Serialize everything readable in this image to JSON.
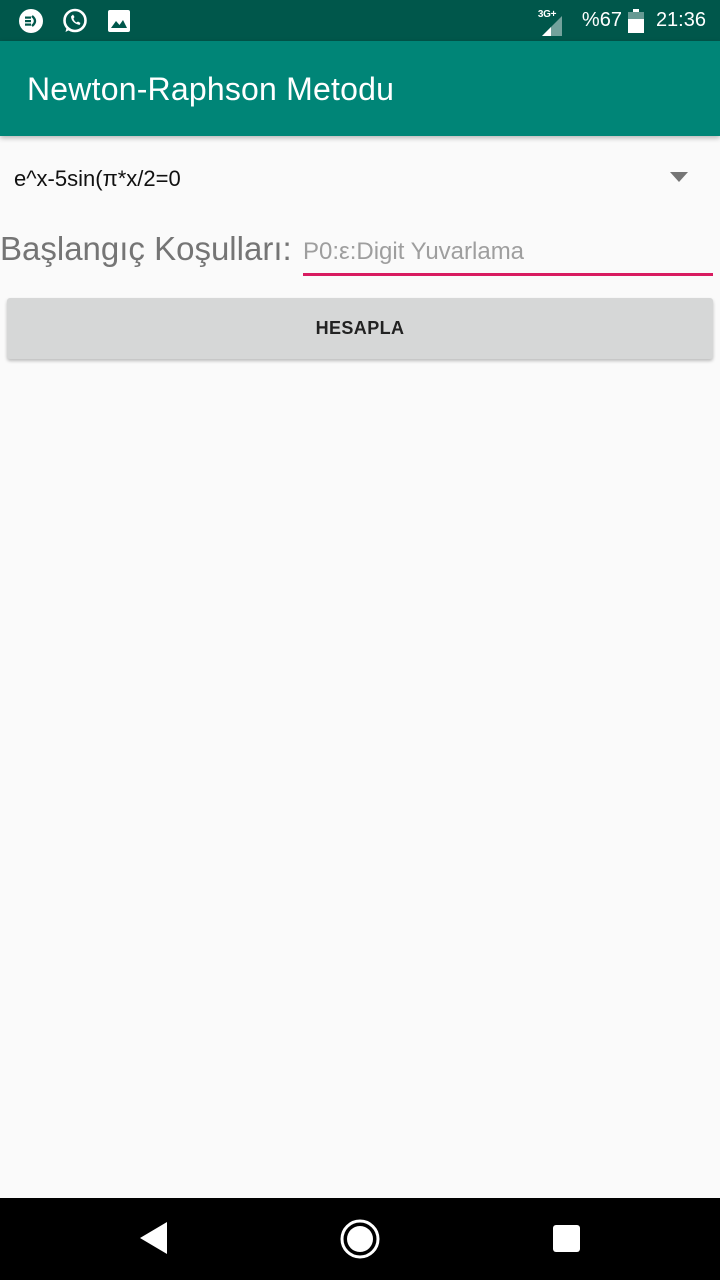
{
  "status_bar": {
    "network_type": "3G+",
    "battery_text": "%67",
    "time": "21:36"
  },
  "app_bar": {
    "title": "Newton-Raphson Metodu"
  },
  "spinner": {
    "selected": "e^x-5sin(π*x/2=0"
  },
  "conditions": {
    "label": "Başlangıç Koşulları:",
    "input_value": "",
    "input_placeholder": "P0:ε:Digit Yuvarlama"
  },
  "calculate_button": {
    "label": "HESAPLA"
  },
  "colors": {
    "status_bar": "#00574b",
    "app_bar": "#008577",
    "accent": "#d81b60",
    "background": "#fafafa",
    "button": "#d6d7d7"
  },
  "icons": {
    "status_left": [
      "messenger-icon",
      "whatsapp-icon",
      "image-icon"
    ],
    "status_right": [
      "signal-icon",
      "battery-icon"
    ],
    "navigation": [
      "back-icon",
      "home-icon",
      "recents-icon"
    ]
  }
}
